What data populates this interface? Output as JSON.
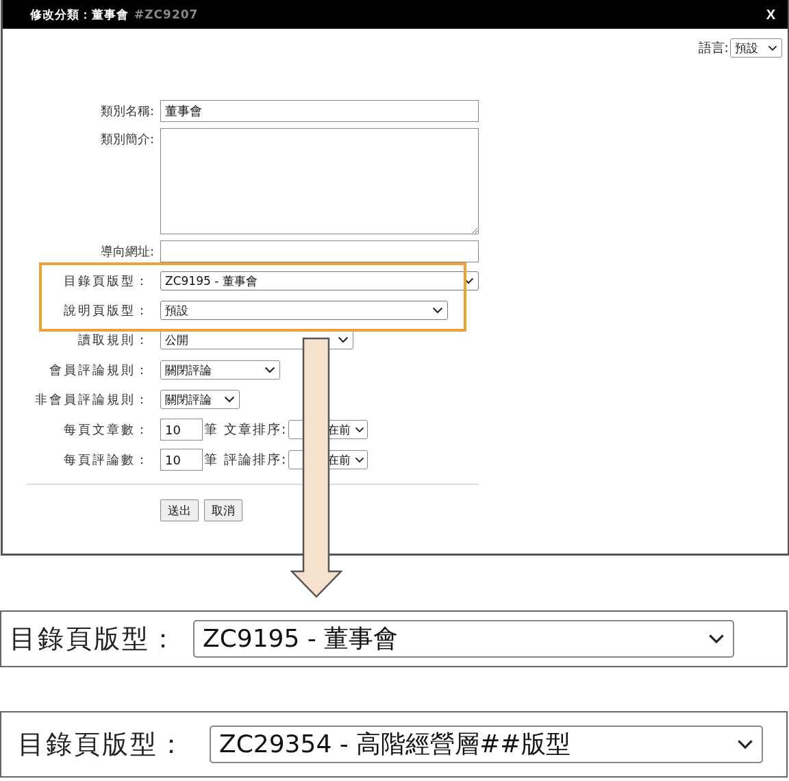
{
  "window": {
    "title": "修改分類：董事會",
    "id": "#ZC9207",
    "close": "X"
  },
  "language": {
    "label": "語言:",
    "value": "預設"
  },
  "fields": [
    {
      "kind": "text",
      "label": "類別名稱:",
      "value": "董事會"
    },
    {
      "kind": "textarea",
      "label": "類別簡介:"
    },
    {
      "kind": "text",
      "label": "導向網址:"
    },
    {
      "kind": "select",
      "label": "目錄頁版型：",
      "value": "ZC9195 - 董事會",
      "highlighted": true
    },
    {
      "kind": "select",
      "label": "說明頁版型：",
      "value": "預設",
      "highlighted": true
    },
    {
      "kind": "select",
      "label": "讀取規則：",
      "value": "公開",
      "highlighted": false
    },
    {
      "kind": "select",
      "label": "會員評論規則：",
      "value": "關閉評論",
      "highlighted": false
    },
    {
      "kind": "select",
      "label": "非會員評論規則：",
      "value": "關閉評論",
      "highlighted": false
    },
    {
      "kind": "count",
      "label": "每頁文章數：",
      "value": "10",
      "unit": "筆",
      "sort_label": "文章排序:",
      "sort_value": "在前"
    },
    {
      "kind": "count",
      "label": "每頁評論數：",
      "value": "10",
      "unit": "筆",
      "sort_label": "評論排序:",
      "sort_value": "在前"
    }
  ],
  "buttons": [
    "送出",
    "取消"
  ],
  "zoom_views": [
    {
      "label": "目錄頁版型：",
      "value": "ZC9195 - 董事會"
    },
    {
      "label": "目錄頁版型：",
      "value": "ZC29354 - 高階經營層##版型"
    }
  ]
}
